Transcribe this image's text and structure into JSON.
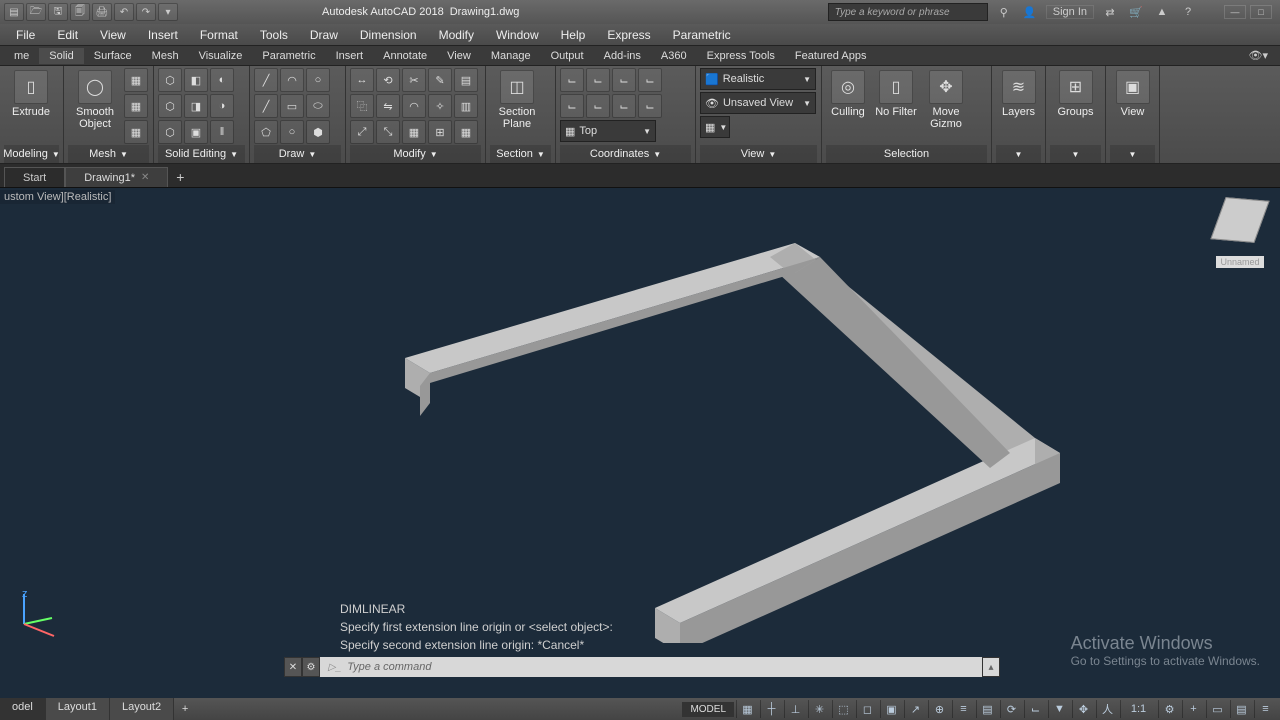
{
  "app": {
    "name": "Autodesk AutoCAD 2018",
    "doc": "Drawing1.dwg"
  },
  "search": {
    "placeholder": "Type a keyword or phrase"
  },
  "signin": "Sign In",
  "menu": [
    "File",
    "Edit",
    "View",
    "Insert",
    "Format",
    "Tools",
    "Draw",
    "Dimension",
    "Modify",
    "Window",
    "Help",
    "Express",
    "Parametric"
  ],
  "ribbon_tabs": [
    "me",
    "Solid",
    "Surface",
    "Mesh",
    "Visualize",
    "Parametric",
    "Insert",
    "Annotate",
    "View",
    "Manage",
    "Output",
    "Add-ins",
    "A360",
    "Express Tools",
    "Featured Apps"
  ],
  "panels": {
    "modeling": {
      "title": "Modeling",
      "extrude": "Extrude"
    },
    "mesh": {
      "title": "Mesh",
      "smooth": "Smooth Object"
    },
    "solid_editing": {
      "title": "Solid Editing"
    },
    "draw": {
      "title": "Draw"
    },
    "modify": {
      "title": "Modify"
    },
    "section": {
      "title": "Section",
      "section_plane": "Section Plane"
    },
    "coordinates": {
      "title": "Coordinates",
      "top": "Top"
    },
    "view": {
      "title": "View",
      "style": "Realistic",
      "unsaved": "Unsaved View"
    },
    "selection": {
      "title": "Selection",
      "culling": "Culling",
      "no_filter": "No Filter",
      "move_gizmo": "Move Gizmo"
    },
    "layers": {
      "title": "Layers"
    },
    "groups": {
      "title": "Groups"
    },
    "view_panel": {
      "title": "View"
    }
  },
  "filetabs": {
    "start": "Start",
    "active": "Drawing1*"
  },
  "viewport_label": "ustom View][Realistic]",
  "viewcube_label": "Unnamed",
  "cmd": {
    "cmd_name": "DIMLINEAR",
    "line1": "Specify first extension line origin or <select object>:",
    "line2": "Specify second extension line origin: *Cancel*",
    "placeholder": "Type a command"
  },
  "activate": {
    "h": "Activate Windows",
    "s": "Go to Settings to activate Windows."
  },
  "layouts": [
    "odel",
    "Layout1",
    "Layout2"
  ],
  "status": {
    "mode": "MODEL",
    "scale": "1:1"
  }
}
